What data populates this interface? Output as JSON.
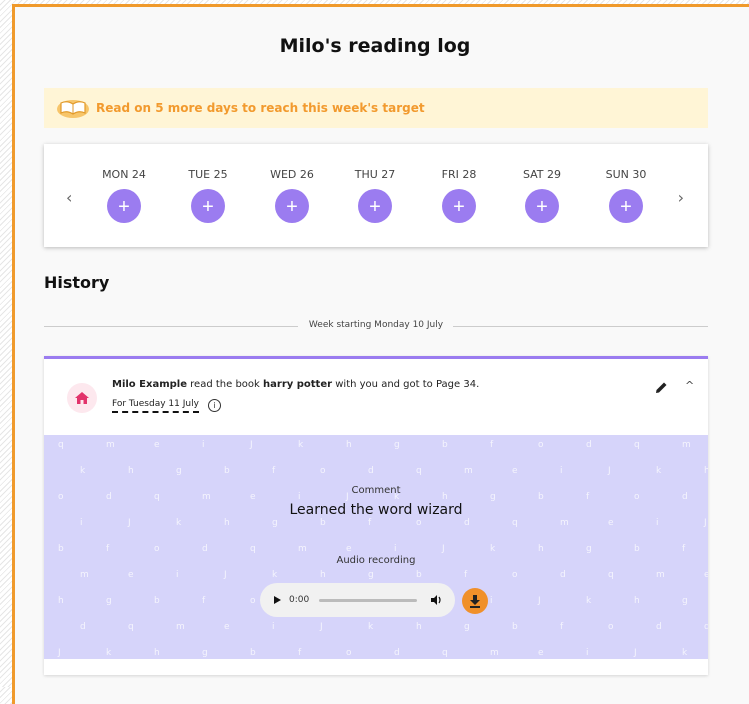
{
  "page": {
    "title": "Milo's reading log"
  },
  "banner": {
    "text": "Read on 5 more days to reach this week's target",
    "icon": "open-book-icon"
  },
  "week": {
    "prev_icon": "‹",
    "next_icon": "›",
    "add_symbol": "+",
    "days": [
      {
        "label": "MON 24"
      },
      {
        "label": "TUE 25"
      },
      {
        "label": "WED 26"
      },
      {
        "label": "THU 27"
      },
      {
        "label": "FRI 28"
      },
      {
        "label": "SAT 29"
      },
      {
        "label": "SUN 30"
      }
    ]
  },
  "history": {
    "heading": "History",
    "week_label": "Week starting Monday 10 July",
    "entry": {
      "reader": "Milo Example",
      "text_read_book": " read the book ",
      "book": "harry potter",
      "text_suffix": " with you and got to Page 34.",
      "date": "For Tuesday 11 July",
      "info_symbol": "i",
      "comment_label": "Comment",
      "comment": "Learned the word wizard",
      "audio_label": "Audio recording",
      "audio_time": "0:00",
      "collapse_symbol": "^"
    }
  },
  "colors": {
    "accent": "#9b7cf0",
    "border": "#f09a2c",
    "banner_bg": "#fff5d6",
    "banner_text": "#f29a2e",
    "detail_bg": "#d6d4fa",
    "download": "#f0902a",
    "home": "#e2336b"
  }
}
